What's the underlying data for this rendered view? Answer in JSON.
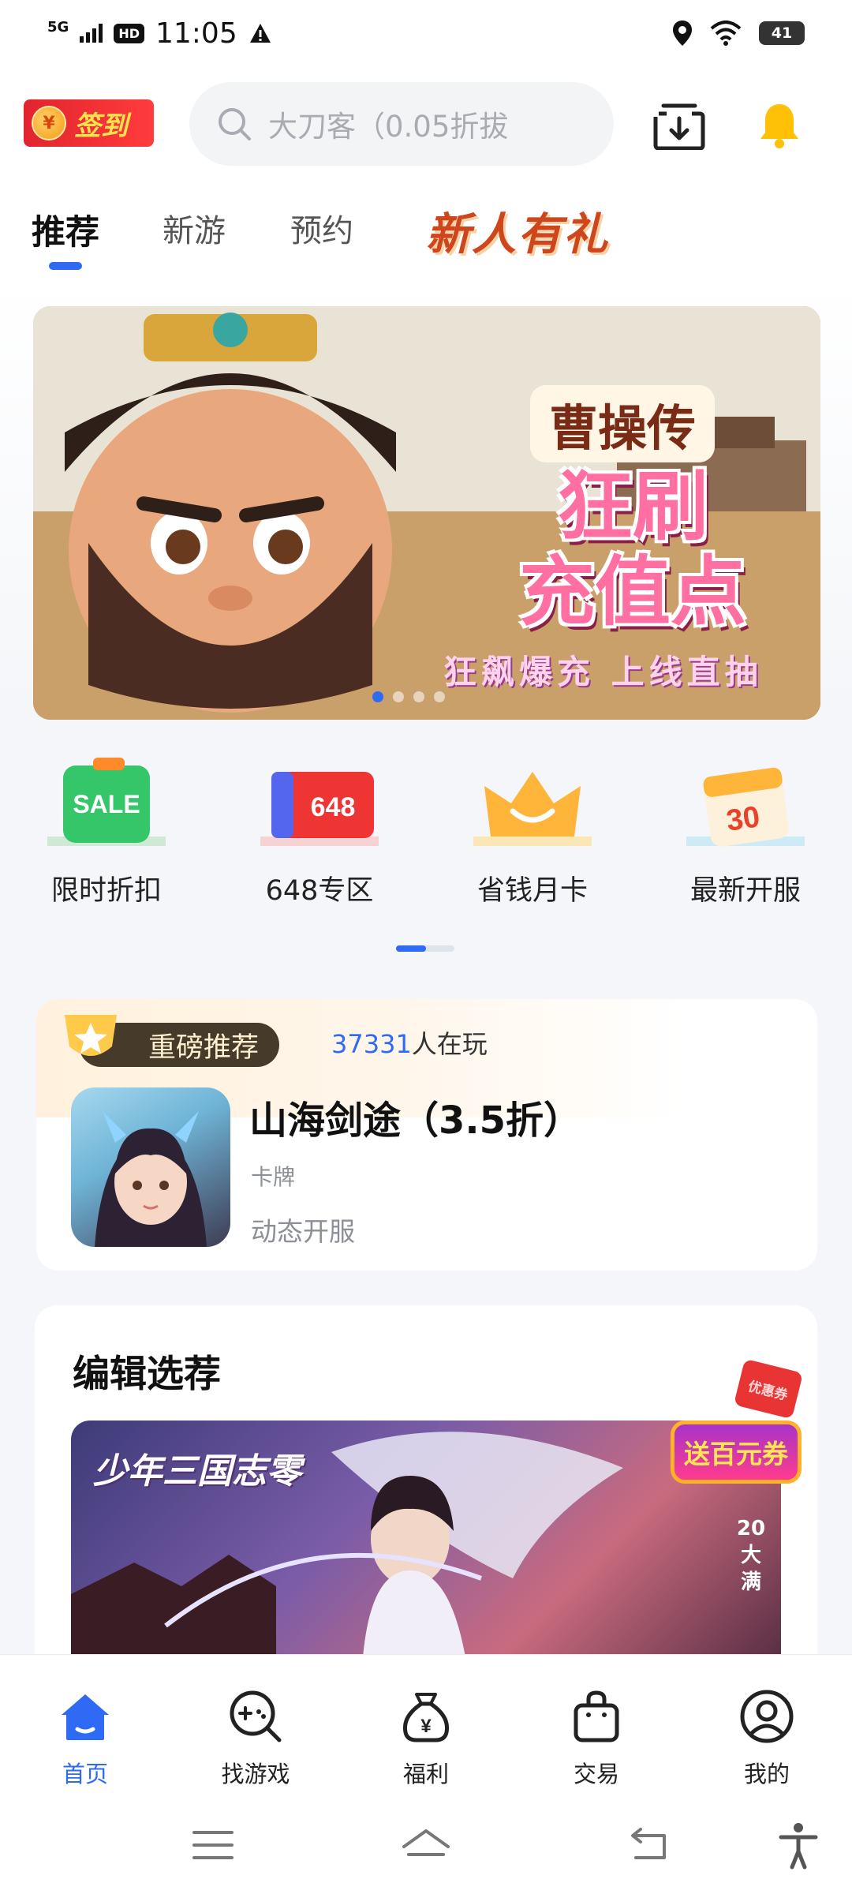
{
  "status_bar": {
    "network": "5G",
    "hd": "HD",
    "time": "11:05",
    "battery": "41"
  },
  "header": {
    "signin_label": "签到",
    "coin_symbol": "¥",
    "search_placeholder": "大刀客（0.05折拔"
  },
  "tabs": [
    {
      "label": "推荐",
      "active": true
    },
    {
      "label": "新游",
      "active": false
    },
    {
      "label": "预约",
      "active": false
    }
  ],
  "tab_promo": "新人有礼",
  "banner": {
    "title": "曹操传",
    "main_line1": "狂刷",
    "main_line2": "充值点",
    "subtitle": "狂飙爆充 上线直抽",
    "page_count": 4,
    "active_page": 1
  },
  "quick_entries": [
    {
      "label": "限时折扣",
      "icon": "sale-tag-icon",
      "icon_text": "SALE"
    },
    {
      "label": "648专区",
      "icon": "ticket-648-icon",
      "icon_text": "648"
    },
    {
      "label": "省钱月卡",
      "icon": "crown-icon"
    },
    {
      "label": "最新开服",
      "icon": "calendar-30-icon",
      "icon_text": "30"
    }
  ],
  "featured": {
    "badge": "重磅推荐",
    "players_count": "37331",
    "players_suffix": "人在玩",
    "game_title": "山海剑途（3.5折）",
    "genre": "卡牌",
    "server_info": "动态开服"
  },
  "editor_picks": {
    "title": "编辑选荐",
    "game_logo": "少年三国志零",
    "side_text": "20大满",
    "coupon_label": "送百元券",
    "coupon_tag": "优惠券"
  },
  "bottom_nav": [
    {
      "label": "首页",
      "icon": "home-icon",
      "active": true
    },
    {
      "label": "找游戏",
      "icon": "find-game-icon",
      "active": false
    },
    {
      "label": "福利",
      "icon": "money-bag-icon",
      "active": false
    },
    {
      "label": "交易",
      "icon": "shopping-bag-icon",
      "active": false
    },
    {
      "label": "我的",
      "icon": "profile-icon",
      "active": false
    }
  ],
  "colors": {
    "accent": "#2f6af5",
    "signin_bg": "#e1242e",
    "bell": "#ffc107"
  }
}
